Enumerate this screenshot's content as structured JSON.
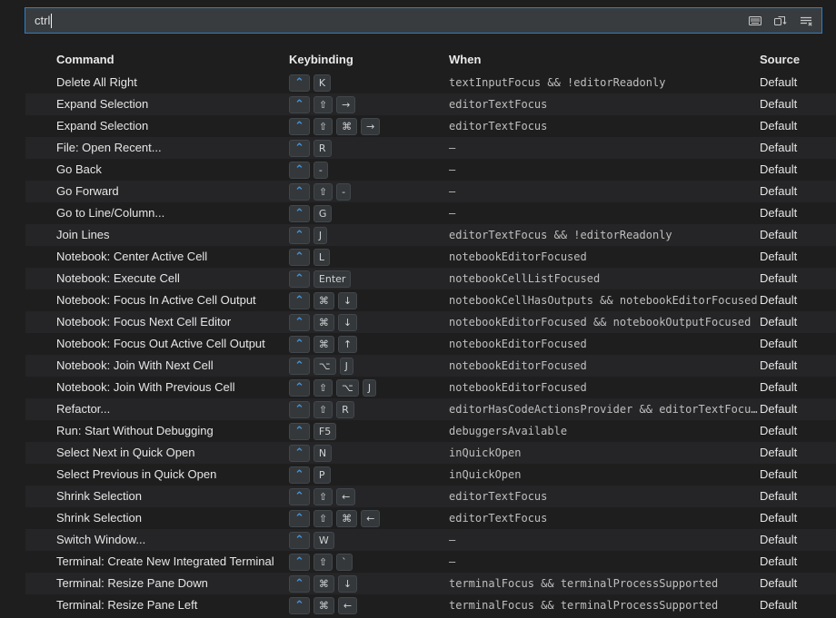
{
  "search": {
    "value": "ctrl",
    "icons": [
      {
        "name": "record-keys-icon"
      },
      {
        "name": "sort-by-precedence-icon"
      },
      {
        "name": "clear-keybindings-search-icon"
      }
    ]
  },
  "table": {
    "headers": {
      "command": "Command",
      "keybinding": "Keybinding",
      "when": "When",
      "source": "Source"
    },
    "rows": [
      {
        "command": "Delete All Right",
        "keys": [
          "⌃",
          "K"
        ],
        "when": "textInputFocus && !editorReadonly",
        "source": "Default"
      },
      {
        "command": "Expand Selection",
        "keys": [
          "⌃",
          "⇧",
          "→"
        ],
        "when": "editorTextFocus",
        "source": "Default"
      },
      {
        "command": "Expand Selection",
        "keys": [
          "⌃",
          "⇧",
          "⌘",
          "→"
        ],
        "when": "editorTextFocus",
        "source": "Default"
      },
      {
        "command": "File: Open Recent...",
        "keys": [
          "⌃",
          "R"
        ],
        "when": "—",
        "source": "Default"
      },
      {
        "command": "Go Back",
        "keys": [
          "⌃",
          "-"
        ],
        "when": "—",
        "source": "Default"
      },
      {
        "command": "Go Forward",
        "keys": [
          "⌃",
          "⇧",
          "-"
        ],
        "when": "—",
        "source": "Default"
      },
      {
        "command": "Go to Line/Column...",
        "keys": [
          "⌃",
          "G"
        ],
        "when": "—",
        "source": "Default"
      },
      {
        "command": "Join Lines",
        "keys": [
          "⌃",
          "J"
        ],
        "when": "editorTextFocus && !editorReadonly",
        "source": "Default"
      },
      {
        "command": "Notebook: Center Active Cell",
        "keys": [
          "⌃",
          "L"
        ],
        "when": "notebookEditorFocused",
        "source": "Default"
      },
      {
        "command": "Notebook: Execute Cell",
        "keys": [
          "⌃",
          "Enter"
        ],
        "when": "notebookCellListFocused",
        "source": "Default"
      },
      {
        "command": "Notebook: Focus In Active Cell Output",
        "keys": [
          "⌃",
          "⌘",
          "↓"
        ],
        "when": "notebookCellHasOutputs && notebookEditorFocused",
        "source": "Default"
      },
      {
        "command": "Notebook: Focus Next Cell Editor",
        "keys": [
          "⌃",
          "⌘",
          "↓"
        ],
        "when": "notebookEditorFocused && notebookOutputFocused",
        "source": "Default"
      },
      {
        "command": "Notebook: Focus Out Active Cell Output",
        "keys": [
          "⌃",
          "⌘",
          "↑"
        ],
        "when": "notebookEditorFocused",
        "source": "Default"
      },
      {
        "command": "Notebook: Join With Next Cell",
        "keys": [
          "⌃",
          "⌥",
          "J"
        ],
        "when": "notebookEditorFocused",
        "source": "Default"
      },
      {
        "command": "Notebook: Join With Previous Cell",
        "keys": [
          "⌃",
          "⇧",
          "⌥",
          "J"
        ],
        "when": "notebookEditorFocused",
        "source": "Default"
      },
      {
        "command": "Refactor...",
        "keys": [
          "⌃",
          "⇧",
          "R"
        ],
        "when": "editorHasCodeActionsProvider && editorTextFocu…",
        "source": "Default"
      },
      {
        "command": "Run: Start Without Debugging",
        "keys": [
          "⌃",
          "F5"
        ],
        "when": "debuggersAvailable",
        "source": "Default"
      },
      {
        "command": "Select Next in Quick Open",
        "keys": [
          "⌃",
          "N"
        ],
        "when": "inQuickOpen",
        "source": "Default"
      },
      {
        "command": "Select Previous in Quick Open",
        "keys": [
          "⌃",
          "P"
        ],
        "when": "inQuickOpen",
        "source": "Default"
      },
      {
        "command": "Shrink Selection",
        "keys": [
          "⌃",
          "⇧",
          "←"
        ],
        "when": "editorTextFocus",
        "source": "Default"
      },
      {
        "command": "Shrink Selection",
        "keys": [
          "⌃",
          "⇧",
          "⌘",
          "←"
        ],
        "when": "editorTextFocus",
        "source": "Default"
      },
      {
        "command": "Switch Window...",
        "keys": [
          "⌃",
          "W"
        ],
        "when": "—",
        "source": "Default"
      },
      {
        "command": "Terminal: Create New Integrated Terminal",
        "keys": [
          "⌃",
          "⇧",
          "`"
        ],
        "when": "—",
        "source": "Default"
      },
      {
        "command": "Terminal: Resize Pane Down",
        "keys": [
          "⌃",
          "⌘",
          "↓"
        ],
        "when": "terminalFocus && terminalProcessSupported",
        "source": "Default"
      },
      {
        "command": "Terminal: Resize Pane Left",
        "keys": [
          "⌃",
          "⌘",
          "←"
        ],
        "when": "terminalFocus && terminalProcessSupported",
        "source": "Default"
      }
    ]
  },
  "colors": {
    "bg": "#1e1e1e",
    "row-alt": "#252527",
    "input-bg": "#393c3f",
    "focus-border": "#2b80c9",
    "key-bg": "#34383b",
    "key-border": "#42474b",
    "key-text": "#d0d3d5",
    "ctrl-blue": "#4593d8",
    "text": "#e6e6e6",
    "when-text": "#bfbfbf",
    "header-text": "#eaeaea",
    "icon": "#c8c8c8",
    "caret": "#f0f0f0"
  },
  "ctrl_glyph": "⌃"
}
